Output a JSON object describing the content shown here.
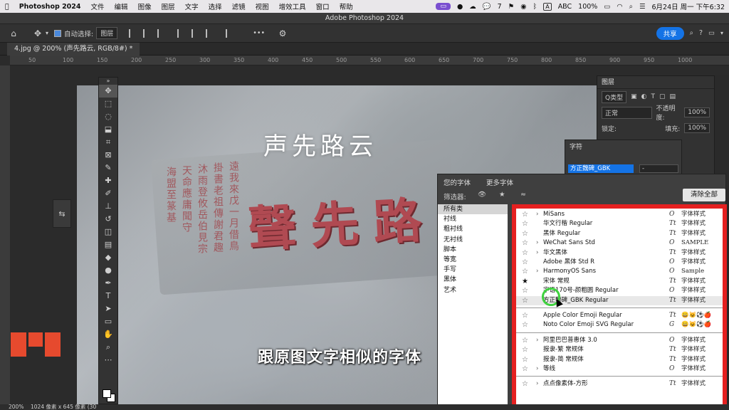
{
  "menubar": {
    "apple": "",
    "items": [
      "Photoshop 2024",
      "文件",
      "编辑",
      "图像",
      "图层",
      "文字",
      "选择",
      "滤镜",
      "视图",
      "增效工具",
      "窗口",
      "帮助"
    ],
    "right": {
      "wechat_count": "7",
      "ime": "A",
      "ime_label": "ABC",
      "battery": "100%",
      "datetime": "6月24日 周一 下午6:32"
    }
  },
  "window": {
    "title": "Adobe Photoshop 2024"
  },
  "options_bar": {
    "auto_select_label": "自动选择:",
    "auto_select_value": "图层",
    "more": "•••",
    "share_label": "共享"
  },
  "document_tab": {
    "label": "4.jpg @ 200% (声先路云, RGB/8#) *"
  },
  "ruler": {
    "ticks": [
      "50",
      "100",
      "150",
      "200",
      "250",
      "300",
      "350",
      "400",
      "450",
      "500",
      "550",
      "600",
      "650",
      "700",
      "750",
      "800",
      "850",
      "900",
      "950",
      "1000"
    ]
  },
  "canvas": {
    "overlay_title": "声先路云",
    "big_inscription": "聲先路",
    "small_inscription": [
      "遠我來戊一月借鳥",
      "掛書老祖傳謝君趣",
      "沐雨登攸岳伯見宗",
      "天命應庸聞守",
      "海盟至篆基"
    ],
    "subtitle": "跟原图文字相似的字体"
  },
  "status_bar": {
    "zoom": "200%",
    "size_info": "1024 像素 x 645 像素 (30"
  },
  "layers_panel": {
    "title": "图层",
    "kind_label": "Q类型",
    "blend_mode": "正常",
    "opacity_label": "不透明度:",
    "opacity_value": "100%",
    "lock_label": "锁定:",
    "fill_label": "填充:",
    "fill_value": "100%"
  },
  "character_panel": {
    "title": "字符",
    "font_value": "方正魏碑_GBK",
    "style_value": "-"
  },
  "font_dropdown": {
    "tabs": [
      "您的字体",
      "更多字体"
    ],
    "filter_label": "筛选器:",
    "clear_all": "清除全部",
    "categories": [
      "所有类",
      "衬线",
      "粗衬线",
      "无衬线",
      "脚本",
      "等宽",
      "手写",
      "黑体",
      "艺术"
    ],
    "selected_category": "所有类",
    "group1": [
      {
        "name": "MiSans",
        "expand": true,
        "icon": "O",
        "sample": "字体样式",
        "starred": false
      },
      {
        "name": "华文行楷 Regular",
        "expand": false,
        "icon": "Tt",
        "sample": "字体样式",
        "starred": false
      },
      {
        "name": "黑体 Regular",
        "expand": false,
        "icon": "Tt",
        "sample": "字体样式",
        "starred": false
      },
      {
        "name": "WeChat Sans Std",
        "expand": true,
        "icon": "O",
        "sample": "SAMPLE",
        "starred": false
      },
      {
        "name": "华文黑体",
        "expand": true,
        "icon": "Tt",
        "sample": "字体样式",
        "starred": false
      },
      {
        "name": "Adobe 黑体 Std R",
        "expand": false,
        "icon": "O",
        "sample": "字体样式",
        "starred": false
      },
      {
        "name": "HarmonyOS Sans",
        "expand": true,
        "icon": "O",
        "sample": "Sample",
        "starred": false
      },
      {
        "name": "宋体 常规",
        "expand": false,
        "icon": "Tt",
        "sample": "字体样式",
        "starred": true
      },
      {
        "name": "字语170号-颜粗圆 Regular",
        "expand": false,
        "icon": "O",
        "sample": "字体样式",
        "starred": false
      },
      {
        "name": "方正魏碑_GBK Regular",
        "expand": false,
        "icon": "Tt",
        "sample": "字体样式",
        "starred": false,
        "highlighted": true
      }
    ],
    "group2": [
      {
        "name": "Apple Color Emoji Regular",
        "expand": false,
        "icon": "Tt",
        "sample": "😀😺⚽🍎",
        "starred": false
      },
      {
        "name": "Noto Color Emoji SVG Regular",
        "expand": false,
        "icon": "G",
        "sample": "😀😺⚽🍎",
        "starred": false
      }
    ],
    "group3": [
      {
        "name": "阿里巴巴普惠体 3.0",
        "expand": true,
        "icon": "O",
        "sample": "字体样式",
        "starred": false
      },
      {
        "name": "报隶-繁 常规体",
        "expand": false,
        "icon": "Tt",
        "sample": "字体样式",
        "starred": false
      },
      {
        "name": "报隶-简 常规体",
        "expand": false,
        "icon": "Tt",
        "sample": "字体样式",
        "starred": false
      },
      {
        "name": "等线",
        "expand": true,
        "icon": "O",
        "sample": "字体样式",
        "starred": false
      }
    ],
    "group4": [
      {
        "name": "点点像素体-方形",
        "expand": true,
        "icon": "Tt",
        "sample": "字体样式",
        "starred": false
      }
    ]
  },
  "colors": {
    "highlight_border": "#e52020",
    "accent_blue": "#1473e6",
    "inscription_red": "#b04a52",
    "logo_orange": "#e64a2e",
    "cursor_ring": "#3fd23f"
  }
}
